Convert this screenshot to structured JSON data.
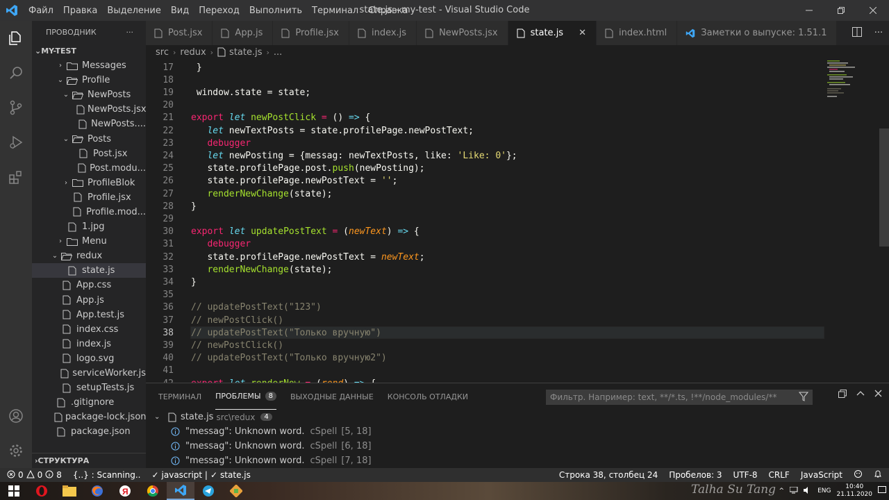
{
  "window": {
    "title": "state.js - my-test - Visual Studio Code",
    "menu": [
      "Файл",
      "Правка",
      "Выделение",
      "Вид",
      "Переход",
      "Выполнить",
      "Терминал",
      "Справка"
    ]
  },
  "sidebar": {
    "header": "ПРОВОДНИК",
    "more": "···",
    "project": "MY-TEST",
    "tree": [
      {
        "label": "Messages",
        "type": "folder",
        "indent": 1,
        "open": false
      },
      {
        "label": "Profile",
        "type": "folder",
        "indent": 1,
        "open": true
      },
      {
        "label": "NewPosts",
        "type": "folder",
        "indent": 2,
        "open": true
      },
      {
        "label": "NewPosts.jsx",
        "type": "file",
        "indent": 3
      },
      {
        "label": "NewPosts....",
        "type": "file",
        "indent": 3
      },
      {
        "label": "Posts",
        "type": "folder",
        "indent": 2,
        "open": true
      },
      {
        "label": "Post.jsx",
        "type": "file",
        "indent": 3
      },
      {
        "label": "Post.modu...",
        "type": "file",
        "indent": 3
      },
      {
        "label": "ProfileBlok",
        "type": "folder",
        "indent": 2,
        "open": false
      },
      {
        "label": "Profile.jsx",
        "type": "file",
        "indent": 2
      },
      {
        "label": "Profile.mod...",
        "type": "file",
        "indent": 2
      },
      {
        "label": "1.jpg",
        "type": "file",
        "indent": 1
      },
      {
        "label": "Menu",
        "type": "folder",
        "indent": 1,
        "open": false
      },
      {
        "label": "redux",
        "type": "folder",
        "indent": 0,
        "open": true
      },
      {
        "label": "state.js",
        "type": "file",
        "indent": 1,
        "selected": true
      },
      {
        "label": "App.css",
        "type": "file",
        "indent": 0
      },
      {
        "label": "App.js",
        "type": "file",
        "indent": 0
      },
      {
        "label": "App.test.js",
        "type": "file",
        "indent": 0
      },
      {
        "label": "index.css",
        "type": "file",
        "indent": 0
      },
      {
        "label": "index.js",
        "type": "file",
        "indent": 0
      },
      {
        "label": "logo.svg",
        "type": "file",
        "indent": 0
      },
      {
        "label": "serviceWorker.js",
        "type": "file",
        "indent": 0
      },
      {
        "label": "setupTests.js",
        "type": "file",
        "indent": 0
      },
      {
        "label": ".gitignore",
        "type": "file",
        "indent": -1
      },
      {
        "label": "package-lock.json",
        "type": "file",
        "indent": -1
      },
      {
        "label": "package.json",
        "type": "file",
        "indent": -1
      }
    ],
    "structure": "СТРУКТУРА"
  },
  "tabs": [
    {
      "label": "Post.jsx",
      "active": false
    },
    {
      "label": "App.js",
      "active": false
    },
    {
      "label": "Profile.jsx",
      "active": false
    },
    {
      "label": "index.js",
      "active": false
    },
    {
      "label": "NewPosts.jsx",
      "active": false
    },
    {
      "label": "state.js",
      "active": true,
      "close": "✕"
    },
    {
      "label": "index.html",
      "active": false
    },
    {
      "label": "Заметки о выпуске: 1.51.1",
      "active": false,
      "vscode": true
    }
  ],
  "breadcrumb": [
    "src",
    "redux",
    "state.js",
    "..."
  ],
  "editor": {
    "current_line": 38,
    "lines": [
      {
        "n": "17",
        "tokens": [
          {
            "t": " }",
            "c": "pl"
          }
        ]
      },
      {
        "n": "18",
        "tokens": []
      },
      {
        "n": "19",
        "tokens": [
          {
            "t": " window.state = state;",
            "c": "pl"
          }
        ]
      },
      {
        "n": "20",
        "tokens": []
      },
      {
        "n": "21",
        "tokens": [
          {
            "t": "export ",
            "c": "kw"
          },
          {
            "t": "let ",
            "c": "kwi"
          },
          {
            "t": "newPostClick",
            "c": "fn"
          },
          {
            "t": " = ",
            "c": "kw"
          },
          {
            "t": "() ",
            "c": "pl"
          },
          {
            "t": "=>",
            "c": "kwi"
          },
          {
            "t": " {",
            "c": "pl"
          }
        ]
      },
      {
        "n": "22",
        "tokens": [
          {
            "t": "   let ",
            "c": "kwi"
          },
          {
            "t": "newTextPosts = state.profilePage.newPostText;",
            "c": "pl"
          }
        ]
      },
      {
        "n": "23",
        "tokens": [
          {
            "t": "   debugger",
            "c": "kw"
          }
        ]
      },
      {
        "n": "24",
        "tokens": [
          {
            "t": "   let ",
            "c": "kwi"
          },
          {
            "t": "newPosting = {messag: newTextPosts, like: ",
            "c": "pl"
          },
          {
            "t": "'Like: 0'",
            "c": "str"
          },
          {
            "t": "};",
            "c": "pl"
          }
        ]
      },
      {
        "n": "25",
        "tokens": [
          {
            "t": "   state.profilePage.post.",
            "c": "pl"
          },
          {
            "t": "push",
            "c": "fn"
          },
          {
            "t": "(newPosting);",
            "c": "pl"
          }
        ]
      },
      {
        "n": "26",
        "tokens": [
          {
            "t": "   state.profilePage.newPostText = ",
            "c": "pl"
          },
          {
            "t": "''",
            "c": "str"
          },
          {
            "t": ";",
            "c": "pl"
          }
        ]
      },
      {
        "n": "27",
        "tokens": [
          {
            "t": "   renderNewChange",
            "c": "fn"
          },
          {
            "t": "(state);",
            "c": "pl"
          }
        ]
      },
      {
        "n": "28",
        "tokens": [
          {
            "t": "}",
            "c": "pl"
          }
        ]
      },
      {
        "n": "29",
        "tokens": []
      },
      {
        "n": "30",
        "tokens": [
          {
            "t": "export ",
            "c": "kw"
          },
          {
            "t": "let ",
            "c": "kwi"
          },
          {
            "t": "updatePostText",
            "c": "fn"
          },
          {
            "t": " = ",
            "c": "kw"
          },
          {
            "t": "(",
            "c": "pl"
          },
          {
            "t": "newText",
            "c": "par"
          },
          {
            "t": ") ",
            "c": "pl"
          },
          {
            "t": "=>",
            "c": "kwi"
          },
          {
            "t": " {",
            "c": "pl"
          }
        ]
      },
      {
        "n": "31",
        "tokens": [
          {
            "t": "   debugger",
            "c": "kw"
          }
        ]
      },
      {
        "n": "32",
        "tokens": [
          {
            "t": "   state.profilePage.newPostText = ",
            "c": "pl"
          },
          {
            "t": "newText",
            "c": "par"
          },
          {
            "t": ";",
            "c": "pl"
          }
        ]
      },
      {
        "n": "33",
        "tokens": [
          {
            "t": "   renderNewChange",
            "c": "fn"
          },
          {
            "t": "(state);",
            "c": "pl"
          }
        ]
      },
      {
        "n": "34",
        "tokens": [
          {
            "t": "}",
            "c": "pl"
          }
        ]
      },
      {
        "n": "35",
        "tokens": []
      },
      {
        "n": "36",
        "tokens": [
          {
            "t": "// updatePostText(\"123\")",
            "c": "cm"
          }
        ]
      },
      {
        "n": "37",
        "tokens": [
          {
            "t": "// newPostClick()",
            "c": "cm"
          }
        ]
      },
      {
        "n": "38",
        "tokens": [
          {
            "t": "// updatePostText(\"Только вручную\")",
            "c": "cm"
          }
        ]
      },
      {
        "n": "39",
        "tokens": [
          {
            "t": "// newPostClick()",
            "c": "cm"
          }
        ]
      },
      {
        "n": "40",
        "tokens": [
          {
            "t": "// updatePostText(\"Только вручную2\")",
            "c": "cm"
          }
        ]
      },
      {
        "n": "41",
        "tokens": []
      },
      {
        "n": "42",
        "tokens": [
          {
            "t": "export ",
            "c": "kw"
          },
          {
            "t": "let ",
            "c": "kwi"
          },
          {
            "t": "renderNow",
            "c": "fn"
          },
          {
            "t": " = ",
            "c": "kw"
          },
          {
            "t": "(",
            "c": "pl"
          },
          {
            "t": "rend",
            "c": "par"
          },
          {
            "t": ") ",
            "c": "pl"
          },
          {
            "t": "=>",
            "c": "kwi"
          },
          {
            "t": " {",
            "c": "pl"
          }
        ]
      }
    ]
  },
  "panel": {
    "tabs": [
      {
        "label": "ТЕРМИНАЛ",
        "active": false
      },
      {
        "label": "ПРОБЛЕМЫ",
        "active": true,
        "badge": "8"
      },
      {
        "label": "ВЫХОДНЫЕ ДАННЫЕ",
        "active": false
      },
      {
        "label": "КОНСОЛЬ ОТЛАДКИ",
        "active": false
      }
    ],
    "filter_placeholder": "Фильтр. Например: text, **/*.ts, !**/node_modules/**",
    "file": {
      "name": "state.js",
      "path": "src\\redux",
      "count": "4"
    },
    "problems": [
      {
        "msg": "\"messag\": Unknown word.",
        "source": "cSpell",
        "pos": "[5, 18]"
      },
      {
        "msg": "\"messag\": Unknown word.",
        "source": "cSpell",
        "pos": "[6, 18]"
      },
      {
        "msg": "\"messag\": Unknown word.",
        "source": "cSpell",
        "pos": "[7, 18]"
      }
    ]
  },
  "status": {
    "errors": "0",
    "warnings": "0",
    "info": "8",
    "scanning": "{..} : Scanning..",
    "javascript": "javascript |",
    "state": "state.js",
    "position": "Строка 38, столбец 24",
    "spaces": "Пробелов: 3",
    "encoding": "UTF-8",
    "eol": "CRLF",
    "language": "JavaScript"
  },
  "taskbar": {
    "lang": "ENG",
    "time": "10:40",
    "date": "21.11.2020",
    "signature": "Talha Su Tang"
  },
  "colors": {
    "accent": "#007acc",
    "statusbar": "#2f2f2f",
    "keyword": "#f92672",
    "function": "#a6e22e",
    "string": "#e6db74",
    "comment": "#88846f"
  }
}
